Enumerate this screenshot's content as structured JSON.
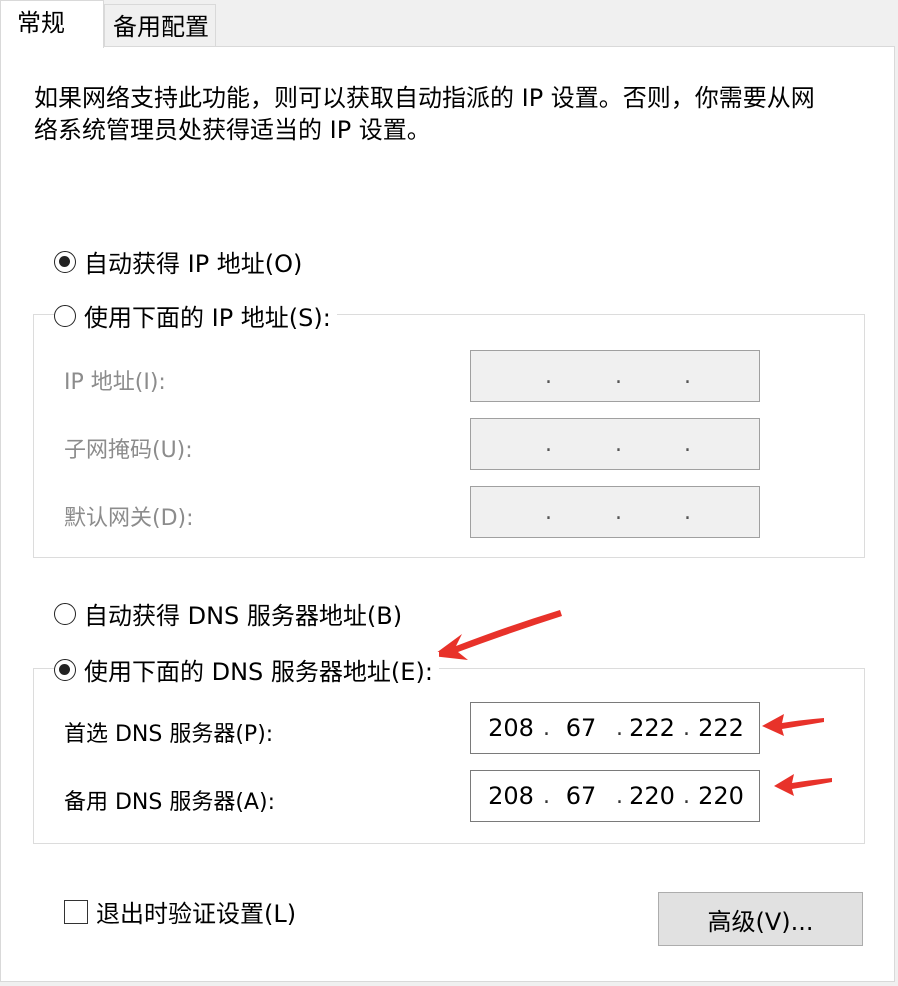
{
  "tabs": [
    {
      "label": "常规",
      "active": true
    },
    {
      "label": "备用配置",
      "active": false
    }
  ],
  "description": "如果网络支持此功能，则可以获取自动指派的 IP 设置。否则，你需要从网络系统管理员处获得适当的 IP 设置。",
  "ip_section": {
    "auto_radio": {
      "label": "自动获得 IP 地址(O)",
      "checked": true
    },
    "manual_radio": {
      "label": "使用下面的 IP 地址(S):",
      "checked": false
    },
    "fields": [
      {
        "label": "IP 地址(I):",
        "octets": [
          "",
          "",
          "",
          ""
        ],
        "enabled": false
      },
      {
        "label": "子网掩码(U):",
        "octets": [
          "",
          "",
          "",
          ""
        ],
        "enabled": false
      },
      {
        "label": "默认网关(D):",
        "octets": [
          "",
          "",
          "",
          ""
        ],
        "enabled": false
      }
    ]
  },
  "dns_section": {
    "auto_radio": {
      "label": "自动获得 DNS 服务器地址(B)",
      "checked": false
    },
    "manual_radio": {
      "label": "使用下面的 DNS 服务器地址(E):",
      "checked": true
    },
    "fields": [
      {
        "label": "首选 DNS 服务器(P):",
        "octets": [
          "208",
          "67",
          "222",
          "222"
        ],
        "enabled": true
      },
      {
        "label": "备用 DNS 服务器(A):",
        "octets": [
          "208",
          "67",
          "220",
          "220"
        ],
        "enabled": true
      }
    ]
  },
  "validate_checkbox": {
    "label": "退出时验证设置(L)",
    "checked": false
  },
  "advanced_button": {
    "label": "高级(V)..."
  },
  "colors": {
    "annotation_arrow": "#e8322a",
    "panel_bg": "#ffffff",
    "window_bg": "#f0f0f0"
  },
  "icons": [
    "annotation-arrow-icon"
  ]
}
